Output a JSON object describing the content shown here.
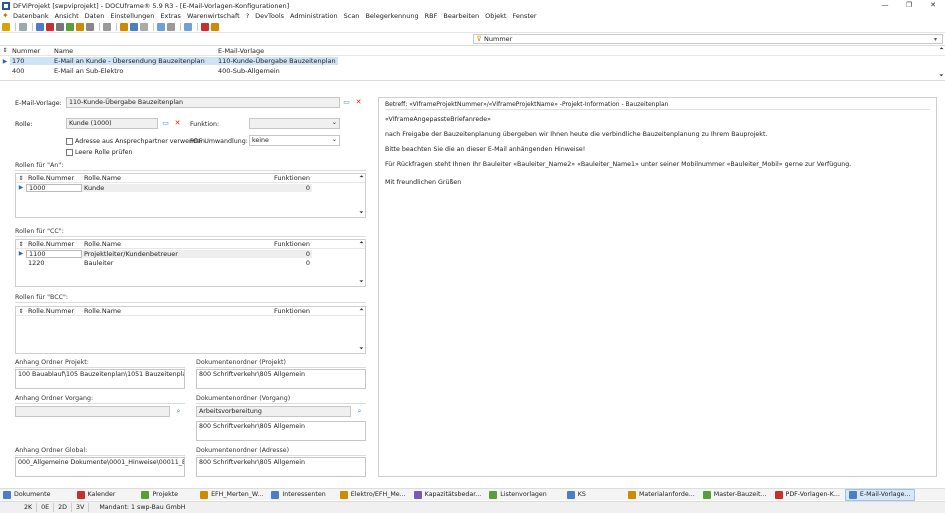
{
  "window": {
    "title": "DFViProjekt [swpviprojekt] - DOCUframe® 5.9 R3 - [E-Mail-Vorlagen-Konfigurationen]",
    "controls": [
      "—",
      "❐",
      "✕"
    ]
  },
  "menu": [
    "Datenbank",
    "Ansicht",
    "Daten",
    "Einstellungen",
    "Extras",
    "Warenwirtschaft",
    "?",
    "DevTools",
    "Administration",
    "Scan",
    "Belegerkennung",
    "RBF",
    "Bearbeiten",
    "Objekt",
    "Fenster"
  ],
  "filter": {
    "value": "Nummer"
  },
  "topgrid": {
    "columns": [
      "Nummer",
      "Name",
      "E-Mail-Vorlage"
    ],
    "rows": [
      {
        "nummer": "170",
        "name": "E-Mail an Kunde - Übersendung Bauzeitenplan",
        "vorlage": "110-Kunde-Übergabe Bauzeitenplan",
        "selected": true
      },
      {
        "nummer": "400",
        "name": "E-Mail an Sub-Elektro",
        "vorlage": "400-Sub-Allgemein",
        "selected": false
      }
    ]
  },
  "form": {
    "email_vorlage_label": "E-Mail-Vorlage:",
    "email_vorlage_value": "110-Kunde-Übergabe Bauzeitenplan",
    "rolle_label": "Rolle:",
    "rolle_value": "Kunde (1000)",
    "funktion_label": "Funktion:",
    "funktion_value": "",
    "pdf_label": "PDF Umwandlung:",
    "pdf_value": "keine",
    "chk_adresse": "Adresse aus Ansprechpartner verwenden",
    "chk_leere": "Leere Rolle prüfen"
  },
  "rollen_an": {
    "title": "Rollen für \"An\":",
    "columns": [
      "Rolle.Nummer",
      "Rolle.Name",
      "Funktionen"
    ],
    "rows": [
      {
        "nummer": "1000",
        "name": "Kunde",
        "funktionen": "0"
      }
    ]
  },
  "rollen_cc": {
    "title": "Rollen für \"CC\":",
    "columns": [
      "Rolle.Nummer",
      "Rolle.Name",
      "Funktionen"
    ],
    "rows": [
      {
        "nummer": "1100",
        "name": "Projektleiter/Kundenbetreuer",
        "funktionen": "0"
      },
      {
        "nummer": "1220",
        "name": "Bauleiter",
        "funktionen": "0"
      }
    ]
  },
  "rollen_bcc": {
    "title": "Rollen für \"BCC\":",
    "columns": [
      "Rolle.Nummer",
      "Rolle.Name",
      "Funktionen"
    ],
    "rows": []
  },
  "anhang": {
    "projekt_label": "Anhang Ordner Projekt:",
    "projekt_value": "100 Bauablauf\\105 Bauzeitenplan\\1051 Bauzeitenplan Kunde",
    "dok_projekt_label": "Dokumentenordner (Projekt)",
    "dok_projekt_value": "800 Schriftverkehr\\805 Allgemein",
    "vorgang_label": "Anhang Ordner Vorgang:",
    "vorgang_value": "",
    "dok_vorgang_label": "Dokumentenordner (Vorgang)",
    "dok_vorgang_value": "Arbeitsvorbereitung",
    "dok_vorgang_value2": "800 Schriftverkehr\\805 Allgemein",
    "global_label": "Anhang Ordner Global:",
    "global_value": "000_Allgemeine Dokumente\\0001_Hinweise\\00011_Bauzeitenplan",
    "dok_adresse_label": "Dokumentenordner (Adresse)",
    "dok_adresse_value": "800 Schriftverkehr\\805 Allgemein"
  },
  "preview": {
    "subject": "Betreff: «VIframeProjektNummer»/«VIframeProjektName» -Projekt-Information - Bauzeitenplan",
    "lines": [
      "«VIframeAngepassteBriefanrede»",
      "nach Freigabe der Bauzeitenplanung übergeben wir Ihnen heute die verbindliche Bauzeitenplanung zu Ihrem Bauprojekt.",
      "Bitte beachten Sie die an dieser E-Mail anhängenden Hinweise!",
      "Für Rückfragen steht Ihnen Ihr Bauleiter «Bauleiter_Name2» «Bauleiter_Name1» unter seiner Mobilnummer «Bauleiter_Mobil» gerne zur Verfügung.",
      "Mit freundlichen Grüßen"
    ]
  },
  "tabs": [
    {
      "label": "Dokumente",
      "color": "#4a7ec9"
    },
    {
      "label": "Kalender",
      "color": "#c9302c"
    },
    {
      "label": "Projekte",
      "color": "#5a9e3a"
    },
    {
      "label": "EFH_Merten_W...",
      "color": "#d08a00"
    },
    {
      "label": "Interessenten",
      "color": "#4a7ec9"
    },
    {
      "label": "Elektro/EFH_Me...",
      "color": "#d08a00"
    },
    {
      "label": "Kapazitätsbedar...",
      "color": "#7a5ab5"
    },
    {
      "label": "Listenvorlagen",
      "color": "#5a9e3a"
    },
    {
      "label": "KS",
      "color": "#4a7ec9"
    },
    {
      "label": "Materialanforde...",
      "color": "#d08a00"
    },
    {
      "label": "Master-Bauzeit...",
      "color": "#5a9e3a"
    },
    {
      "label": "PDF-Vorlagen-K...",
      "color": "#c9302c"
    },
    {
      "label": "E-Mail-Vorlage...",
      "color": "#4a7ec9"
    }
  ],
  "status": {
    "items": [
      "2K",
      "0E",
      "2D",
      "3V"
    ],
    "mandant": "Mandant: 1 swp-Bau GmbH"
  }
}
